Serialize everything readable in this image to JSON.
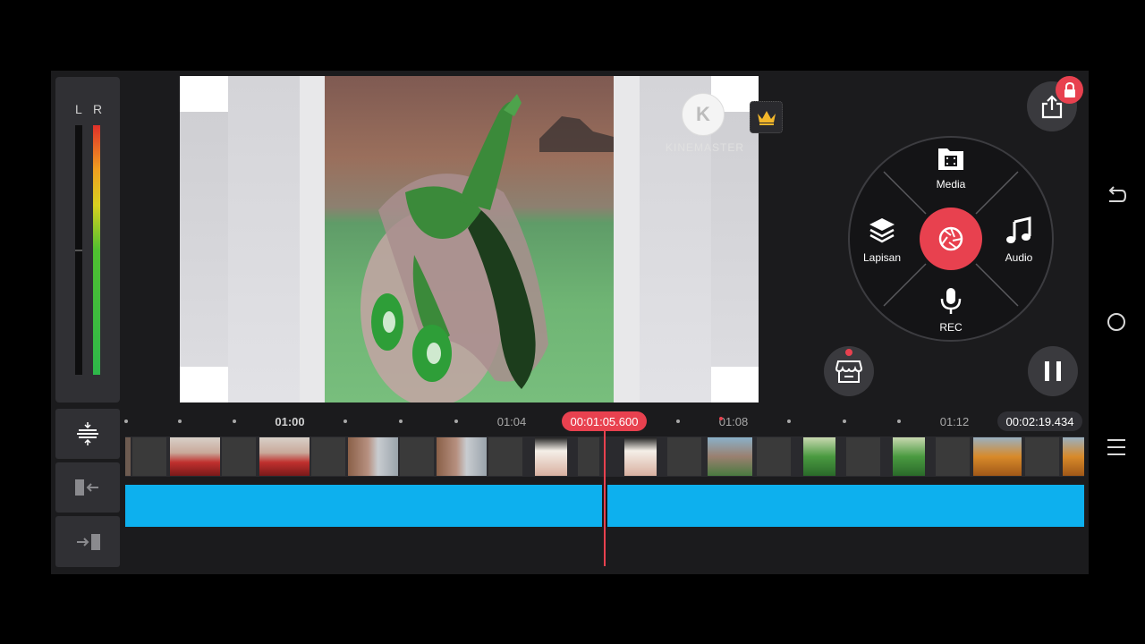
{
  "meter": {
    "left_label": "L",
    "right_label": "R",
    "left_level": 0.0,
    "right_level": 1.0
  },
  "preview": {
    "watermark": "KINEMASTER",
    "watermark_logo_letter": "K"
  },
  "menu": {
    "media_label": "Media",
    "layer_label": "Lapisan",
    "audio_label": "Audio",
    "rec_label": "REC"
  },
  "timeline": {
    "ticks": [
      "01:00",
      "01:04",
      "01:08",
      "01:12"
    ],
    "playhead_time": "00:01:05.600",
    "total_time": "00:02:19.434"
  },
  "colors": {
    "accent": "#e8414f",
    "audio_track": "#0db0ee"
  },
  "icons": [
    "export-icon",
    "lock-icon",
    "crown-icon",
    "store-icon",
    "pause-icon",
    "media-icon",
    "layers-icon",
    "music-icon",
    "mic-icon",
    "camera-shutter-icon",
    "back-icon",
    "home-icon",
    "menu-icon",
    "collapse-tracks-icon",
    "trim-left-icon",
    "trim-right-icon"
  ]
}
